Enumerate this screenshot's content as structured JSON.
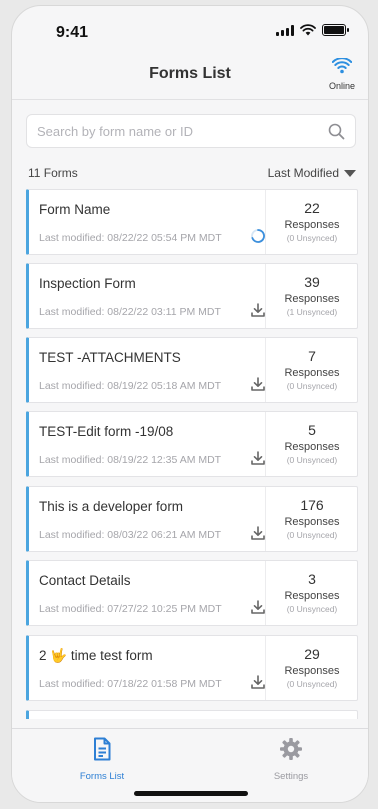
{
  "status_bar": {
    "time": "9:41"
  },
  "header": {
    "title": "Forms List",
    "online_label": "Online"
  },
  "search": {
    "placeholder": "Search by form name or ID",
    "value": ""
  },
  "list_info": {
    "count_label": "11 Forms",
    "sort_label": "Last Modified"
  },
  "forms": [
    {
      "name": "Form Name",
      "modified": "Last modified: 08/22/22 05:54 PM MDT",
      "status_icon": "sync-spinner-icon",
      "responses": "22",
      "responses_label": "Responses",
      "unsynced": "(0 Unsynced)"
    },
    {
      "name": "Inspection Form",
      "modified": "Last modified: 08/22/22 03:11 PM MDT",
      "status_icon": "download-icon",
      "responses": "39",
      "responses_label": "Responses",
      "unsynced": "(1 Unsynced)"
    },
    {
      "name": "TEST -ATTACHMENTS",
      "modified": "Last modified: 08/19/22 05:18 AM MDT",
      "status_icon": "download-icon",
      "responses": "7",
      "responses_label": "Responses",
      "unsynced": "(0 Unsynced)"
    },
    {
      "name": "TEST-Edit form -19/08",
      "modified": "Last modified: 08/19/22 12:35 AM MDT",
      "status_icon": "download-icon",
      "responses": "5",
      "responses_label": "Responses",
      "unsynced": "(0 Unsynced)"
    },
    {
      "name": "This is a developer form",
      "modified": "Last modified: 08/03/22 06:21 AM MDT",
      "status_icon": "download-icon",
      "responses": "176",
      "responses_label": "Responses",
      "unsynced": "(0 Unsynced)"
    },
    {
      "name": "Contact Details",
      "modified": "Last modified: 07/27/22 10:25 PM MDT",
      "status_icon": "download-icon",
      "responses": "3",
      "responses_label": "Responses",
      "unsynced": "(0 Unsynced)"
    },
    {
      "name": "2 🤟 time test form",
      "modified": "Last modified: 07/18/22 01:58 PM MDT",
      "status_icon": "download-icon",
      "responses": "29",
      "responses_label": "Responses",
      "unsynced": "(0 Unsynced)"
    }
  ],
  "tabs": [
    {
      "label": "Forms List",
      "icon": "document-icon",
      "active": true
    },
    {
      "label": "Settings",
      "icon": "gear-icon",
      "active": false
    }
  ],
  "colors": {
    "accent": "#2d7fd4",
    "card_border": "#4ba5df",
    "online": "#2d8fe0"
  }
}
